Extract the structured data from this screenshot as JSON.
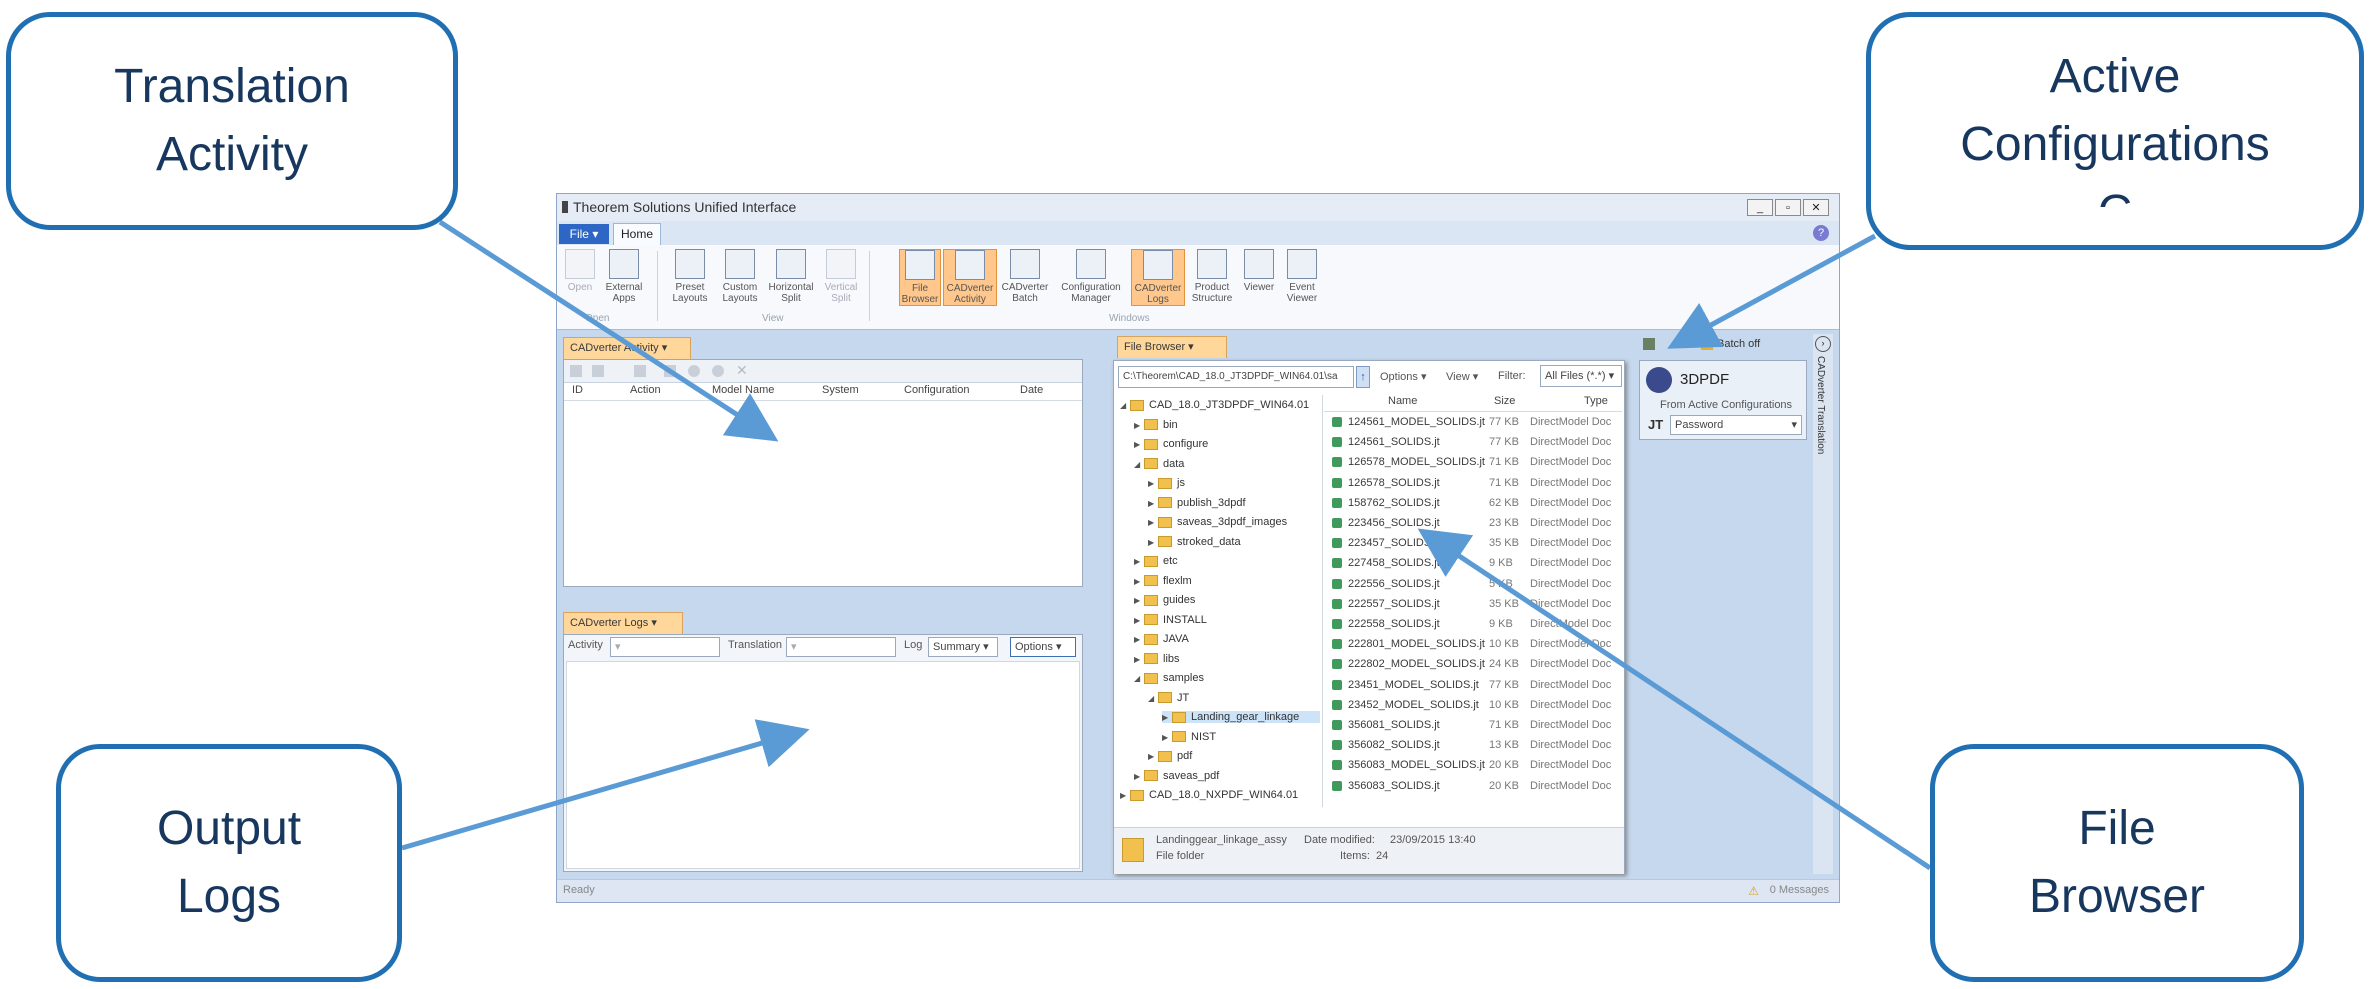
{
  "callouts": {
    "translation_activity": [
      "Translation",
      "Activity"
    ],
    "active_configurations": [
      "Active",
      "Configurations",
      "C"
    ],
    "output_logs": [
      "Output",
      "Logs"
    ],
    "file_browser": [
      "File",
      "Browser"
    ]
  },
  "app": {
    "title": "Theorem Solutions Unified Interface",
    "menu": {
      "file_label": "File",
      "home_tab": "Home"
    },
    "ribbon": {
      "buttons": {
        "open": "Open",
        "external_apps": "External Apps",
        "preset_layouts": "Preset Layouts",
        "custom_layouts": "Custom Layouts",
        "horizontal_split": "Horizontal Split",
        "vertical_split": "Vertical Split",
        "file_browser": "File Browser",
        "cadverter_activity": "CADverter Activity",
        "cadverter_batch": "CADverter Batch",
        "configuration_manager": "Configuration Manager",
        "cadverter_logs": "CADverter Logs",
        "product_structure": "Product Structure",
        "viewer": "Viewer",
        "event_viewer": "Event Viewer"
      },
      "groups": {
        "open": "Open",
        "view": "View",
        "windows": "Windows"
      }
    },
    "activity_panel": {
      "tab": "CADverter Activity",
      "columns": [
        "ID",
        "Action",
        "Model Name",
        "System",
        "Configuration",
        "Date"
      ]
    },
    "logs_panel": {
      "tab": "CADverter Logs",
      "activity_label": "Activity",
      "translation_label": "Translation",
      "log_label": "Log",
      "log_value": "Summary",
      "options": "Options"
    },
    "file_browser": {
      "tab": "File Browser",
      "path": "C:\\Theorem\\CAD_18.0_JT3DPDF_WIN64.01\\sa",
      "options": "Options",
      "view": "View",
      "filter_label": "Filter:",
      "filter_value": "All Files (*.*)",
      "tree": [
        {
          "label": "CAD_18.0_JT3DPDF_WIN64.01",
          "level": 0,
          "open": true
        },
        {
          "label": "bin",
          "level": 1
        },
        {
          "label": "configure",
          "level": 1
        },
        {
          "label": "data",
          "level": 1,
          "open": true
        },
        {
          "label": "js",
          "level": 2
        },
        {
          "label": "publish_3dpdf",
          "level": 2
        },
        {
          "label": "saveas_3dpdf_images",
          "level": 2
        },
        {
          "label": "stroked_data",
          "level": 2
        },
        {
          "label": "etc",
          "level": 1
        },
        {
          "label": "flexlm",
          "level": 1
        },
        {
          "label": "guides",
          "level": 1
        },
        {
          "label": "INSTALL",
          "level": 1
        },
        {
          "label": "JAVA",
          "level": 1
        },
        {
          "label": "libs",
          "level": 1
        },
        {
          "label": "samples",
          "level": 1,
          "open": true
        },
        {
          "label": "JT",
          "level": 2,
          "open": true
        },
        {
          "label": "Landing_gear_linkage",
          "level": 3,
          "selected": true
        },
        {
          "label": "NIST",
          "level": 3
        },
        {
          "label": "pdf",
          "level": 2
        },
        {
          "label": "saveas_pdf",
          "level": 1
        },
        {
          "label": "CAD_18.0_NXPDF_WIN64.01",
          "level": 0
        }
      ],
      "columns": {
        "name": "Name",
        "size": "Size",
        "type": "Type"
      },
      "files": [
        {
          "name": "124561_MODEL_SOLIDS.jt",
          "size": "77 KB",
          "type": "DirectModel Doc"
        },
        {
          "name": "124561_SOLIDS.jt",
          "size": "77 KB",
          "type": "DirectModel Doc"
        },
        {
          "name": "126578_MODEL_SOLIDS.jt",
          "size": "71 KB",
          "type": "DirectModel Doc"
        },
        {
          "name": "126578_SOLIDS.jt",
          "size": "71 KB",
          "type": "DirectModel Doc"
        },
        {
          "name": "158762_SOLIDS.jt",
          "size": "62 KB",
          "type": "DirectModel Doc"
        },
        {
          "name": "223456_SOLIDS.jt",
          "size": "23 KB",
          "type": "DirectModel Doc"
        },
        {
          "name": "223457_SOLIDS.jt",
          "size": "35 KB",
          "type": "DirectModel Doc"
        },
        {
          "name": "227458_SOLIDS.jt",
          "size": "9 KB",
          "type": "DirectModel Doc"
        },
        {
          "name": "222556_SOLIDS.jt",
          "size": "5 KB",
          "type": "DirectModel Doc"
        },
        {
          "name": "222557_SOLIDS.jt",
          "size": "35 KB",
          "type": "DirectModel Doc"
        },
        {
          "name": "222558_SOLIDS.jt",
          "size": "9 KB",
          "type": "DirectModel Doc"
        },
        {
          "name": "222801_MODEL_SOLIDS.jt",
          "size": "10 KB",
          "type": "DirectModel Doc"
        },
        {
          "name": "222802_MODEL_SOLIDS.jt",
          "size": "24 KB",
          "type": "DirectModel Doc"
        },
        {
          "name": "23451_MODEL_SOLIDS.jt",
          "size": "77 KB",
          "type": "DirectModel Doc"
        },
        {
          "name": "23452_MODEL_SOLIDS.jt",
          "size": "10 KB",
          "type": "DirectModel Doc"
        },
        {
          "name": "356081_SOLIDS.jt",
          "size": "71 KB",
          "type": "DirectModel Doc"
        },
        {
          "name": "356082_SOLIDS.jt",
          "size": "13 KB",
          "type": "DirectModel Doc"
        },
        {
          "name": "356083_MODEL_SOLIDS.jt",
          "size": "20 KB",
          "type": "DirectModel Doc"
        },
        {
          "name": "356083_SOLIDS.jt",
          "size": "20 KB",
          "type": "DirectModel Doc"
        }
      ],
      "details": {
        "name": "Landinggear_linkage_assy",
        "modified_label": "Date modified:",
        "modified": "23/09/2015 13:40",
        "kind": "File folder",
        "items_label": "Items:",
        "items": "24"
      }
    },
    "config_panel": {
      "batch_label": "Batch off",
      "title": "3DPDF",
      "from_label": "From Active Configurations",
      "format_label": "JT",
      "format_value": "Password"
    },
    "side_tab": "CADverter Translation",
    "status": {
      "left": "Ready",
      "right": "0 Messages"
    }
  }
}
